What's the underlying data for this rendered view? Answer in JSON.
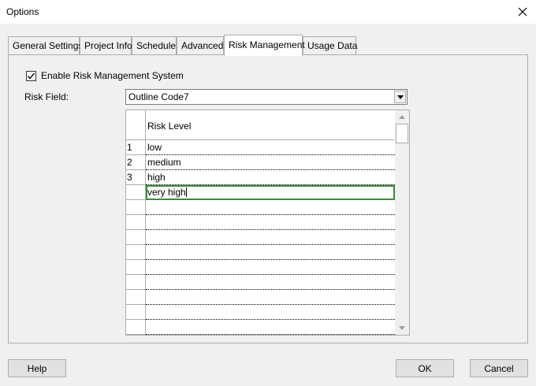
{
  "window": {
    "title": "Options",
    "close_icon": "close-icon"
  },
  "tabs": [
    {
      "label": "General Settings",
      "active": false
    },
    {
      "label": "Project Info",
      "active": false
    },
    {
      "label": "Schedule",
      "active": false
    },
    {
      "label": "Advanced",
      "active": false
    },
    {
      "label": "Risk Management",
      "active": true
    },
    {
      "label": "Usage Data",
      "active": false
    }
  ],
  "risk": {
    "enable_label": "Enable Risk Management System",
    "enable_checked": true,
    "field_label": "Risk Field:",
    "field_value": "Outline Code7"
  },
  "grid": {
    "header": "Risk Level",
    "rows": [
      {
        "num": "1",
        "value": "low"
      },
      {
        "num": "2",
        "value": "medium"
      },
      {
        "num": "3",
        "value": "high"
      },
      {
        "num": "",
        "value": "very high",
        "editing": true
      }
    ],
    "empty_rows": 9
  },
  "buttons": {
    "help": "Help",
    "ok": "OK",
    "cancel": "Cancel"
  },
  "colors": {
    "edit_border": "#3c8a3c",
    "background": "#f0f0f0"
  }
}
